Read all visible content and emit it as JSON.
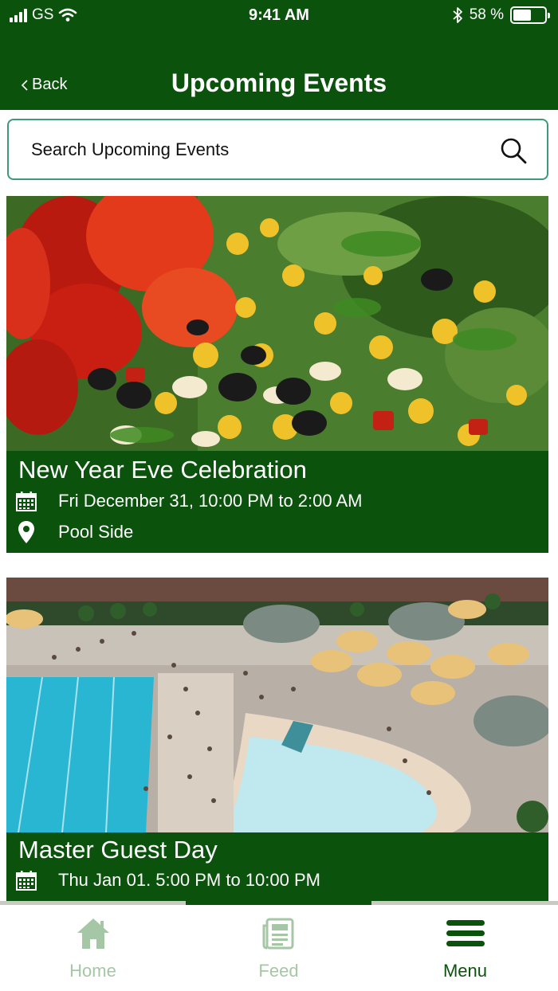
{
  "status_bar": {
    "carrier": "GS",
    "time": "9:41 AM",
    "battery": "58 %",
    "battery_level_percent": 58
  },
  "header": {
    "back_label": "Back",
    "title": "Upcoming Events",
    "color": "#0b520c"
  },
  "search": {
    "placeholder": "Search Upcoming Events",
    "border_color": "#3e9a76"
  },
  "events": [
    {
      "name": "New Year Eve Celebration",
      "datetime": "Fri December 31, 10:00 PM to 2:00 AM",
      "location": "Pool Side",
      "image": "salad-photo"
    },
    {
      "name": "Master Guest Day",
      "datetime": "Thu Jan 01. 5:00 PM to 10:00 PM",
      "image": "pool-photo"
    }
  ],
  "tabbar": {
    "tabs": [
      {
        "label": "Home",
        "icon": "home-icon",
        "active": false
      },
      {
        "label": "Feed",
        "icon": "feed-icon",
        "active": false
      },
      {
        "label": "Menu",
        "icon": "menu-icon",
        "active": true
      }
    ]
  }
}
